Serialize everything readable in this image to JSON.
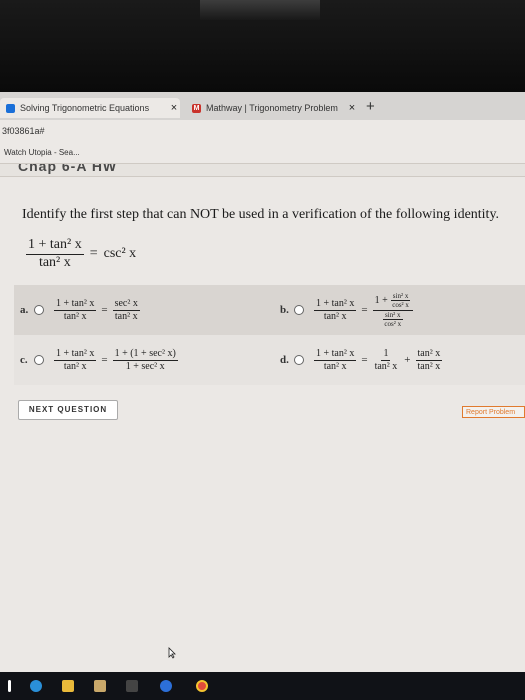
{
  "browser": {
    "tabs": [
      {
        "title": "Solving Trigonometric Equations",
        "close": "×",
        "favicon": "document-icon"
      },
      {
        "title": "Mathway | Trigonometry Problem",
        "close": "×",
        "favicon": "mathway-icon",
        "favicon_text": "M"
      }
    ],
    "new_tab": "+",
    "address": "3f03861a#",
    "bookmark": "Watch Utopia - Sea..."
  },
  "page": {
    "chapter_header": "Chap 6-A HW",
    "question": "Identify the first step that can NOT be used in a verification of the following identity.",
    "identity": {
      "num": "1 + tan² x",
      "den": "tan² x",
      "rhs": "csc² x"
    },
    "options": [
      {
        "letter": "a.",
        "lhs_num": "1 + tan² x",
        "lhs_den": "tan² x",
        "rhs_num": "sec² x",
        "rhs_den": "tan² x"
      },
      {
        "letter": "b.",
        "lhs_num": "1 + tan² x",
        "lhs_den": "tan² x",
        "rhs_num_a": "1 +",
        "rhs_num_b_num": "sin² x",
        "rhs_num_b_den": "cos² x",
        "rhs_den_num": "sin² x",
        "rhs_den_den": "cos² x"
      },
      {
        "letter": "c.",
        "lhs_num": "1 + tan² x",
        "lhs_den": "tan² x",
        "rhs_num": "1 + (1 + sec² x)",
        "rhs_den": "1 + sec² x"
      },
      {
        "letter": "d.",
        "lhs_num": "1 + tan² x",
        "lhs_den": "tan² x",
        "rhs1_num": "1",
        "rhs1_den": "tan² x",
        "plus": "+",
        "rhs2_num": "tan² x",
        "rhs2_den": "tan² x"
      }
    ],
    "eq": "=",
    "next_button": "NEXT QUESTION",
    "report_button": "Report Problem"
  },
  "taskbar_icons": [
    "windows-icon",
    "edge-icon",
    "explorer-icon",
    "store-icon",
    "onenote-icon",
    "chrome-icon",
    "app-icon"
  ]
}
